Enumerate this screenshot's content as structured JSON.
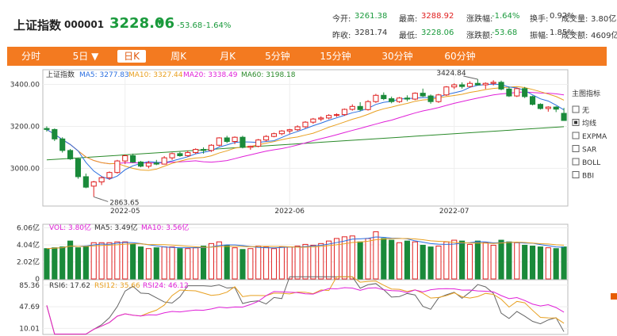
{
  "header": {
    "name": "上证指数",
    "code": "000001",
    "price": "3228.06",
    "arrow": "▼",
    "change": "-53.68",
    "change_pct": "-1.64%",
    "stats_row1": [
      {
        "k": "今开:",
        "v": "3261.38",
        "c": "g"
      },
      {
        "k": "最高:",
        "v": "3288.92",
        "c": "r"
      },
      {
        "k": "涨跌幅:",
        "v": "-1.64%",
        "c": "g"
      },
      {
        "k": "换手:",
        "v": "0.92%",
        "c": ""
      },
      {
        "k": "成交量:",
        "v": "3.80亿",
        "c": ""
      }
    ],
    "stats_row2": [
      {
        "k": "昨收:",
        "v": "3281.74",
        "c": ""
      },
      {
        "k": "最低:",
        "v": "3228.06",
        "c": "g"
      },
      {
        "k": "涨跌额:",
        "v": "-53.68",
        "c": "g"
      },
      {
        "k": "振幅:",
        "v": "1.85%",
        "c": ""
      },
      {
        "k": "成交额:",
        "v": "4609亿",
        "c": ""
      }
    ]
  },
  "tabs": [
    "分时",
    "5日 ▼",
    "日K",
    "周K",
    "月K",
    "5分钟",
    "15分钟",
    "30分钟",
    "60分钟"
  ],
  "active_tab": 2,
  "colors": {
    "up": "#e02020",
    "down": "#1a8a3a",
    "ma5": "#2b6fe0",
    "ma10": "#e8a020",
    "ma20": "#e020d8",
    "ma60": "#2a8a2a"
  },
  "main_legend": {
    "title": "上证指数",
    "ma5": "MA5: 3277.83",
    "ma10": "MA10: 3327.44",
    "ma20": "MA20: 3338.49",
    "ma60": "MA60: 3198.18"
  },
  "indicator_panel": {
    "title": "主图指标",
    "items": [
      {
        "label": "无",
        "checked": false
      },
      {
        "label": "均线",
        "checked": true
      },
      {
        "label": "EXPMA",
        "checked": false
      },
      {
        "label": "SAR",
        "checked": false
      },
      {
        "label": "BOLL",
        "checked": false
      },
      {
        "label": "BBI",
        "checked": false
      }
    ]
  },
  "vol_legend": {
    "vol": "VOL: 3.80亿",
    "ma5": "MA5: 3.49亿",
    "ma10": "MA10: 3.56亿"
  },
  "rsi_legend": {
    "rsi6": "RSI6: 17.62",
    "rsi12": "RSI12: 35.66",
    "rsi24": "RSI24: 46.12"
  },
  "chart_data": {
    "type": "candlestick",
    "y_ticks": [
      3000,
      3200,
      3400
    ],
    "y_tick_labels": [
      "3000.00",
      "3200.00",
      "3400.00"
    ],
    "ylim": [
      2820,
      3470
    ],
    "x_labels": [
      {
        "i": 10,
        "t": "2022-05"
      },
      {
        "i": 31,
        "t": "2022-06"
      },
      {
        "i": 52,
        "t": "2022-07"
      }
    ],
    "annotations": [
      {
        "i": 6,
        "label": "2863.65",
        "price": 2863.65,
        "pos": "low"
      },
      {
        "i": 55,
        "label": "3424.84",
        "price": 3424.84,
        "pos": "high"
      }
    ],
    "ohlc": [
      [
        3190,
        3200,
        3175,
        3185
      ],
      [
        3185,
        3190,
        3130,
        3140
      ],
      [
        3140,
        3148,
        3075,
        3085
      ],
      [
        3085,
        3092,
        3040,
        3045
      ],
      [
        3045,
        3050,
        2950,
        2960
      ],
      [
        2960,
        2975,
        2905,
        2910
      ],
      [
        2915,
        2940,
        2864,
        2935
      ],
      [
        2935,
        2962,
        2920,
        2955
      ],
      [
        2955,
        2985,
        2945,
        2980
      ],
      [
        2980,
        3040,
        2975,
        3035
      ],
      [
        3035,
        3065,
        3020,
        3060
      ],
      [
        3060,
        3070,
        3025,
        3030
      ],
      [
        3030,
        3035,
        3005,
        3010
      ],
      [
        3010,
        3035,
        3000,
        3025
      ],
      [
        3025,
        3040,
        3015,
        3020
      ],
      [
        3020,
        3058,
        3018,
        3050
      ],
      [
        3050,
        3075,
        3040,
        3070
      ],
      [
        3070,
        3078,
        3055,
        3060
      ],
      [
        3060,
        3085,
        3055,
        3075
      ],
      [
        3075,
        3095,
        3068,
        3090
      ],
      [
        3090,
        3100,
        3070,
        3085
      ],
      [
        3085,
        3115,
        3078,
        3110
      ],
      [
        3110,
        3148,
        3105,
        3145
      ],
      [
        3145,
        3155,
        3120,
        3128
      ],
      [
        3128,
        3152,
        3115,
        3148
      ],
      [
        3148,
        3155,
        3095,
        3100
      ],
      [
        3100,
        3108,
        3088,
        3105
      ],
      [
        3105,
        3140,
        3100,
        3135
      ],
      [
        3135,
        3158,
        3128,
        3152
      ],
      [
        3152,
        3170,
        3148,
        3165
      ],
      [
        3165,
        3182,
        3158,
        3178
      ],
      [
        3178,
        3188,
        3165,
        3184
      ],
      [
        3184,
        3205,
        3178,
        3198
      ],
      [
        3198,
        3225,
        3192,
        3220
      ],
      [
        3220,
        3240,
        3212,
        3235
      ],
      [
        3235,
        3248,
        3225,
        3240
      ],
      [
        3240,
        3258,
        3234,
        3252
      ],
      [
        3252,
        3262,
        3245,
        3256
      ],
      [
        3256,
        3285,
        3250,
        3281
      ],
      [
        3281,
        3305,
        3275,
        3295
      ],
      [
        3295,
        3315,
        3272,
        3280
      ],
      [
        3280,
        3325,
        3275,
        3318
      ],
      [
        3318,
        3355,
        3312,
        3348
      ],
      [
        3348,
        3362,
        3325,
        3332
      ],
      [
        3332,
        3342,
        3310,
        3318
      ],
      [
        3318,
        3340,
        3312,
        3335
      ],
      [
        3335,
        3348,
        3320,
        3330
      ],
      [
        3330,
        3362,
        3325,
        3358
      ],
      [
        3358,
        3380,
        3340,
        3345
      ],
      [
        3345,
        3352,
        3308,
        3318
      ],
      [
        3318,
        3355,
        3312,
        3350
      ],
      [
        3350,
        3392,
        3345,
        3388
      ],
      [
        3388,
        3405,
        3378,
        3398
      ],
      [
        3398,
        3410,
        3380,
        3390
      ],
      [
        3390,
        3415,
        3385,
        3405
      ],
      [
        3405,
        3425,
        3395,
        3398
      ],
      [
        3398,
        3410,
        3378,
        3405
      ],
      [
        3405,
        3420,
        3395,
        3410
      ],
      [
        3410,
        3418,
        3372,
        3378
      ],
      [
        3378,
        3390,
        3340,
        3345
      ],
      [
        3345,
        3385,
        3340,
        3380
      ],
      [
        3380,
        3388,
        3335,
        3342
      ],
      [
        3342,
        3346,
        3300,
        3305
      ],
      [
        3305,
        3310,
        3280,
        3285
      ],
      [
        3285,
        3296,
        3270,
        3292
      ],
      [
        3292,
        3296,
        3268,
        3282
      ],
      [
        3262,
        3288,
        3228,
        3228
      ]
    ],
    "volume": [
      3.6,
      3.7,
      3.8,
      4.5,
      3.7,
      3.9,
      4.3,
      4.3,
      4.3,
      4.4,
      4.4,
      4.1,
      3.8,
      3.6,
      3.7,
      3.8,
      3.8,
      3.6,
      3.6,
      3.7,
      3.9,
      4.2,
      4.4,
      4.0,
      3.7,
      3.5,
      3.6,
      3.9,
      3.8,
      3.6,
      3.8,
      3.8,
      3.9,
      4.1,
      4.0,
      4.2,
      4.5,
      4.8,
      5.0,
      5.1,
      4.4,
      4.8,
      5.6,
      4.8,
      4.6,
      4.3,
      4.5,
      4.4,
      4.0,
      3.8,
      3.9,
      4.4,
      4.6,
      4.5,
      4.1,
      4.5,
      4.3,
      4.0,
      4.6,
      4.4,
      4.3,
      4.0,
      3.9,
      3.8,
      3.7,
      3.6,
      3.8
    ],
    "vol_ticks": [
      0,
      2.02,
      4.04,
      6.06
    ],
    "vol_tick_labels": [
      "0",
      "2.02亿",
      "4.04亿",
      "6.06亿"
    ],
    "rsi_ticks": [
      10.01,
      47.69,
      85.36
    ],
    "rsi_tick_labels": [
      "10.01",
      "47.69",
      "85.36"
    ]
  }
}
